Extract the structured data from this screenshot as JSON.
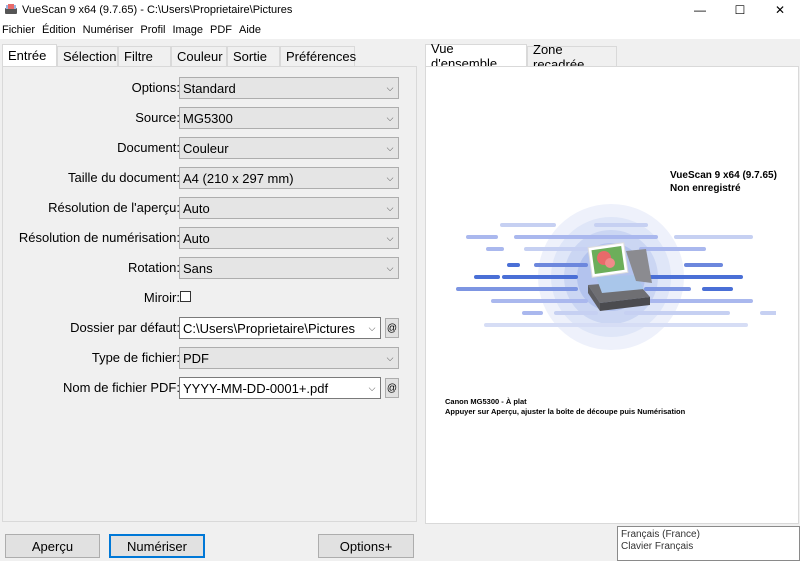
{
  "window": {
    "title": "VueScan 9 x64 (9.7.65) - C:\\Users\\Proprietaire\\Pictures",
    "minimize_glyph": "—",
    "maximize_glyph": "☐",
    "close_glyph": "✕"
  },
  "menu": [
    "Fichier",
    "Édition",
    "Numériser",
    "Profil",
    "Image",
    "PDF",
    "Aide"
  ],
  "left_tabs": [
    {
      "label": "Entrée",
      "active": true
    },
    {
      "label": "Sélection",
      "active": false
    },
    {
      "label": "Filtre",
      "active": false
    },
    {
      "label": "Couleur",
      "active": false
    },
    {
      "label": "Sortie",
      "active": false
    },
    {
      "label": "Préférences",
      "active": false
    }
  ],
  "form": {
    "options": {
      "label": "Options:",
      "value": "Standard"
    },
    "source": {
      "label": "Source:",
      "value": "MG5300"
    },
    "document": {
      "label": "Document:",
      "value": "Couleur"
    },
    "doc_size": {
      "label": "Taille du document:",
      "value": "A4 (210 x 297 mm)"
    },
    "preview_res": {
      "label": "Résolution de l'aperçu:",
      "value": "Auto"
    },
    "scan_res": {
      "label": "Résolution de numérisation:",
      "value": "Auto"
    },
    "rotation": {
      "label": "Rotation:",
      "value": "Sans"
    },
    "mirror": {
      "label": "Miroir:",
      "checked": false
    },
    "default_folder": {
      "label": "Dossier par défaut:",
      "value": "C:\\Users\\Proprietaire\\Pictures"
    },
    "file_type": {
      "label": "Type de fichier:",
      "value": "PDF"
    },
    "pdf_name": {
      "label": "Nom de fichier PDF:",
      "value": "YYYY-MM-DD-0001+.pdf"
    },
    "at_glyph": "@"
  },
  "right_tabs": [
    {
      "label": "Vue d'ensemble",
      "active": true
    },
    {
      "label": "Zone recadrée",
      "active": false
    }
  ],
  "preview": {
    "brand_title": "VueScan 9 x64 (9.7.65)",
    "brand_sub": "Non enregistré",
    "scanner_info": "Canon MG5300 - À plat",
    "hint": "Appuyer sur Aperçu, ajuster la boîte de découpe puis Numérisation"
  },
  "buttons": {
    "preview": "Aperçu",
    "scan": "Numériser",
    "more_options": "Options+"
  },
  "language": {
    "line1": "Français (France)",
    "line2": "Clavier Français"
  },
  "colors": {
    "accent": "#0078d7",
    "illustration_blue": "#4a6fd6",
    "illustration_light": "#aab8ee"
  }
}
